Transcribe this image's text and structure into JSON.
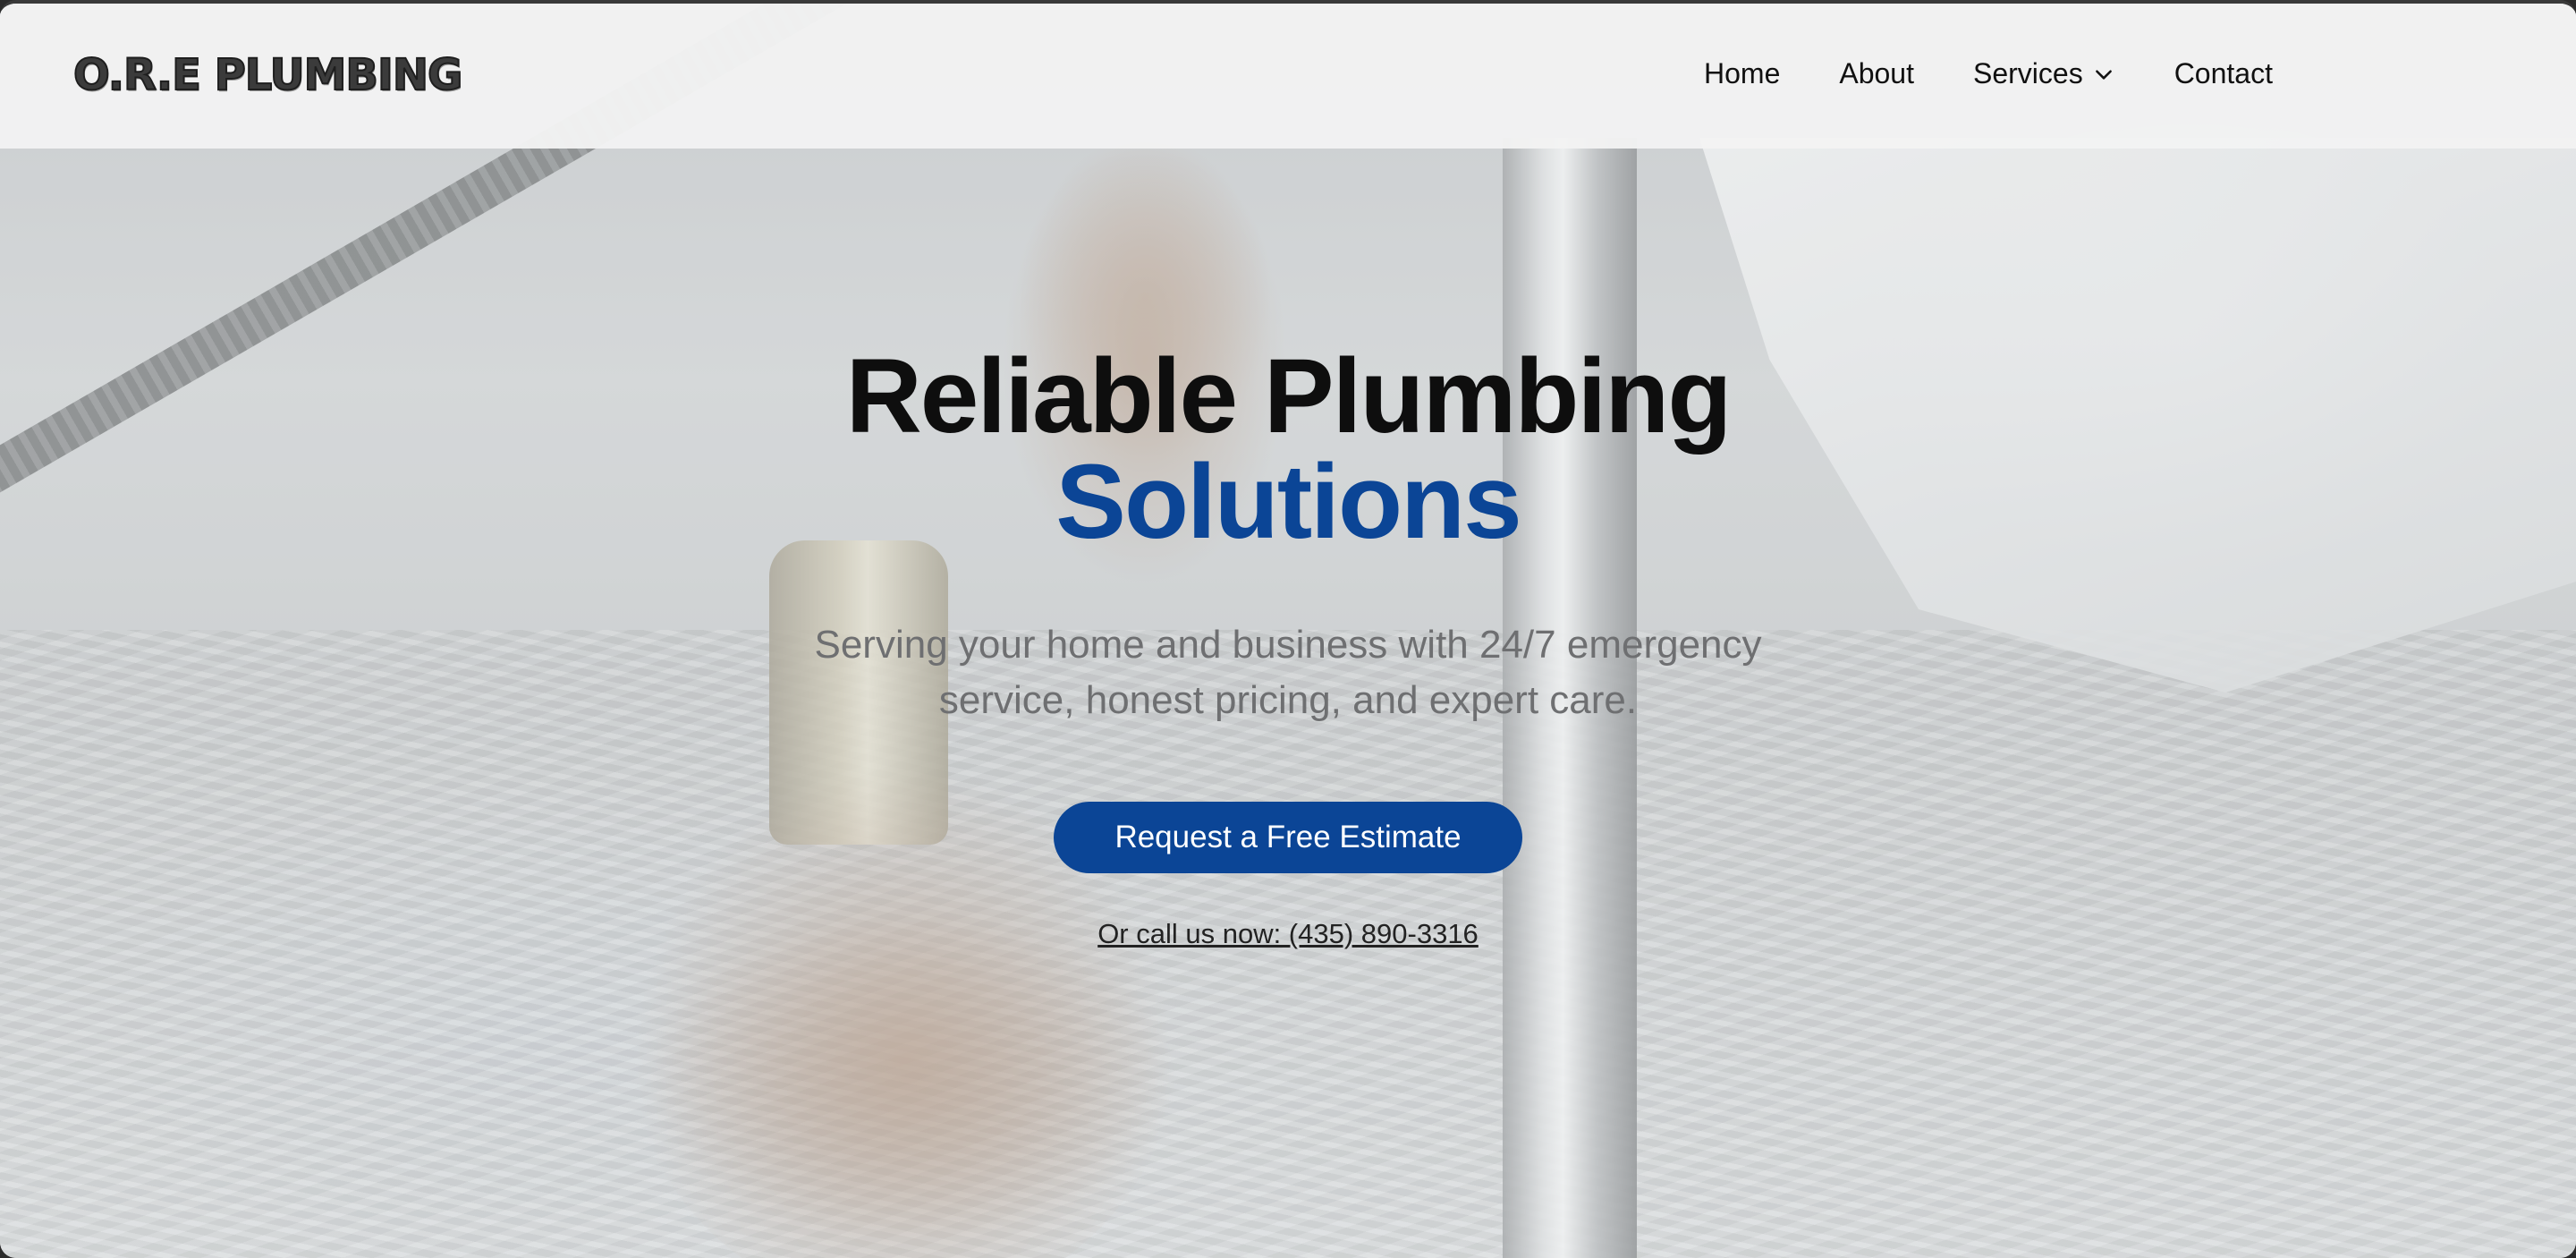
{
  "header": {
    "logo_text": "O.R.E PLUMBING",
    "nav": [
      {
        "label": "Home"
      },
      {
        "label": "About"
      },
      {
        "label": "Services",
        "has_dropdown": true
      },
      {
        "label": "Contact"
      }
    ]
  },
  "hero": {
    "title_line1": "Reliable Plumbing",
    "title_line2": "Solutions",
    "subtitle": "Serving your home and business with 24/7 emergency service, honest pricing, and expert care.",
    "cta_label": "Request a Free Estimate",
    "call_text": "Or call us now: (435) 890-3316"
  },
  "colors": {
    "brand_blue": "#0b4596",
    "header_bg": "#f3f3f3",
    "text_dark": "#0e0e0e",
    "subtitle_gray": "#6e6f71"
  },
  "icons": {
    "services_dropdown": "chevron-down-icon"
  }
}
